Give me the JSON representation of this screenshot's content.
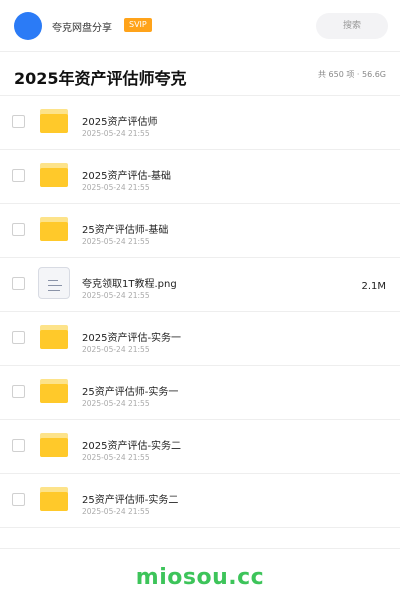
{
  "header": {
    "brand": "夸克网盘分享",
    "badge": "SVIP",
    "search_placeholder": "搜索",
    "colors": {
      "avatar": "#2b7bf6",
      "badge": "#ffa31a"
    }
  },
  "title_bar": {
    "title": "2025年资产评估师夸克",
    "summary": "共 650 项 · 56.6G"
  },
  "items": [
    {
      "type": "folder",
      "name": "2025资产评估师",
      "date": "2025-05-24 21:55",
      "size": ""
    },
    {
      "type": "folder",
      "name": "2025资产评估-基础",
      "date": "2025-05-24 21:55",
      "size": ""
    },
    {
      "type": "folder",
      "name": "25资产评估师-基础",
      "date": "2025-05-24 21:55",
      "size": ""
    },
    {
      "type": "file",
      "name": "夸克领取1T教程.png",
      "date": "2025-05-24 21:55",
      "size": "2.1M"
    },
    {
      "type": "folder",
      "name": "2025资产评估-实务一",
      "date": "2025-05-24 21:55",
      "size": ""
    },
    {
      "type": "folder",
      "name": "25资产评估师-实务一",
      "date": "2025-05-24 21:55",
      "size": ""
    },
    {
      "type": "folder",
      "name": "2025资产评估-实务二",
      "date": "2025-05-24 21:55",
      "size": ""
    },
    {
      "type": "folder",
      "name": "25资产评估师-实务二",
      "date": "2025-05-24 21:55",
      "size": ""
    }
  ],
  "watermark": "miosou.cc",
  "icons": {
    "folder": "folder-icon",
    "file": "file-icon"
  }
}
